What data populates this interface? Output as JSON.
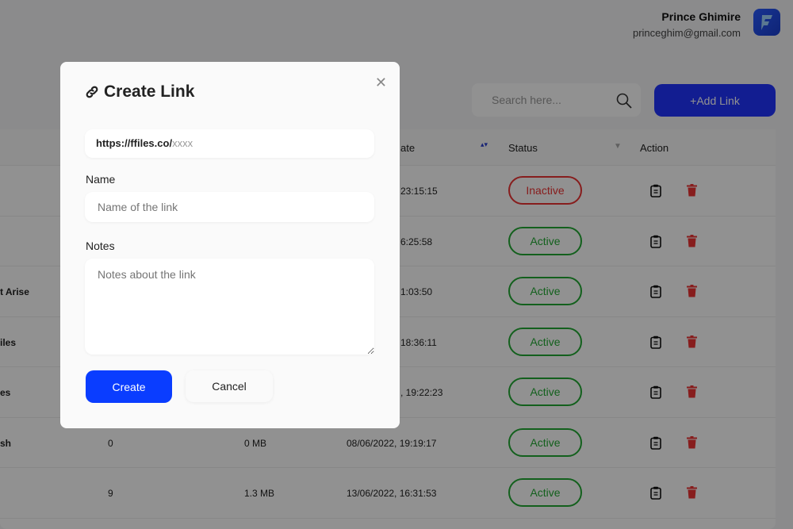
{
  "user": {
    "name": "Prince Ghimire",
    "email": "princeghim@gmail.com"
  },
  "search": {
    "placeholder": "Search here..."
  },
  "add_link_label": "+Add Link",
  "table": {
    "headers": {
      "date": "ate",
      "status": "Status",
      "action": "Action"
    },
    "rows": [
      {
        "name": "",
        "count": "",
        "size": "",
        "date": "23:15:15",
        "status": "Inactive"
      },
      {
        "name": "",
        "count": "",
        "size": "",
        "date": "6:25:58",
        "status": "Active"
      },
      {
        "name": "t Arise",
        "count": "",
        "size": "",
        "date": "1:03:50",
        "status": "Active"
      },
      {
        "name": "iles",
        "count": "",
        "size": "",
        "date": "18:36:11",
        "status": "Active"
      },
      {
        "name": "es",
        "count": "",
        "size": "",
        "date": ", 19:22:23",
        "status": "Active"
      },
      {
        "name": "sh",
        "count": "0",
        "size": "0 MB",
        "date": "08/06/2022, 19:19:17",
        "status": "Active"
      },
      {
        "name": "",
        "count": "9",
        "size": "1.3 MB",
        "date": "13/06/2022, 16:31:53",
        "status": "Active"
      }
    ]
  },
  "modal": {
    "title": "Create Link",
    "url_prefix": "https://ffiles.co/",
    "url_slug": "xxxx",
    "name_label": "Name",
    "name_placeholder": "Name of the link",
    "notes_label": "Notes",
    "notes_placeholder": "Notes about the link",
    "create_label": "Create",
    "cancel_label": "Cancel"
  },
  "colors": {
    "accent": "#0a3dff",
    "active": "#22aa33",
    "inactive": "#ee3333"
  }
}
